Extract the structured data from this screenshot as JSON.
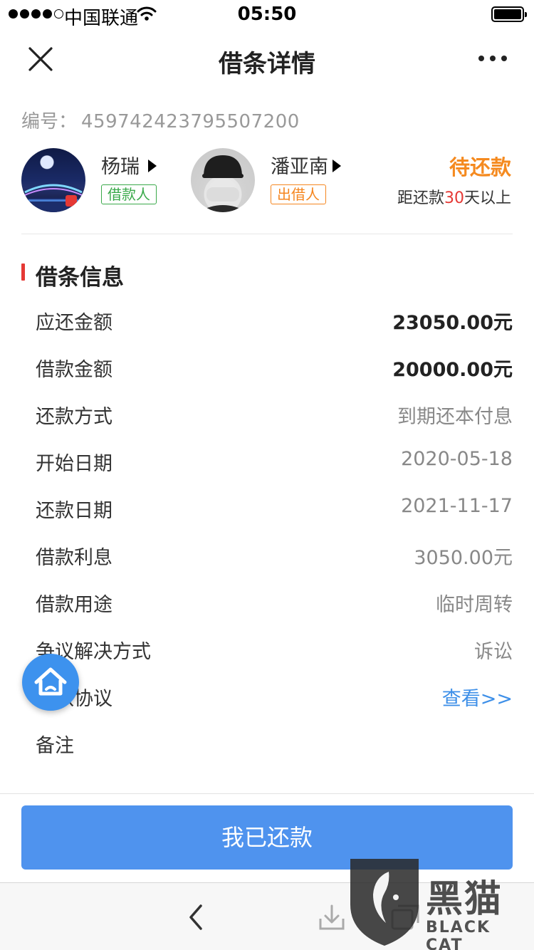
{
  "status_bar": {
    "carrier": "中国联通",
    "time": "05:50"
  },
  "nav": {
    "title": "借条详情"
  },
  "serial": {
    "label": "编号：",
    "value": "459742423795507200"
  },
  "borrower": {
    "name": "杨瑞",
    "role": "借款人"
  },
  "lender": {
    "name": "潘亚南",
    "role": "出借人"
  },
  "loan_status": {
    "label": "待还款",
    "due_prefix": "距还款",
    "due_days": "30",
    "due_suffix": "天以上"
  },
  "section": {
    "title": "借条信息"
  },
  "details": [
    {
      "label": "应还金额",
      "value": "23050.00元"
    },
    {
      "label": "借款金额",
      "value": "20000.00元"
    },
    {
      "label": "还款方式",
      "value": "到期还本付息"
    },
    {
      "label": "开始日期",
      "value": "2020-05-18"
    },
    {
      "label": "还款日期",
      "value": "2021-11-17"
    },
    {
      "label": "借款利息",
      "value": "3050.00元"
    },
    {
      "label": "借款用途",
      "value": "临时周转"
    },
    {
      "label": "争议解决方式",
      "value": "诉讼"
    },
    {
      "label": "借款协议",
      "value": "查看>>"
    },
    {
      "label": "备注",
      "value": ""
    }
  ],
  "actions": {
    "repay_label": "我已还款"
  },
  "watermark": {
    "text": "黑猫",
    "sub": "BLACK CAT"
  },
  "colors": {
    "accent": "#4f93ee",
    "pending": "#f58a1f",
    "borrower_tag": "#3aa94a",
    "lender_tag": "#f5861f",
    "section_marker": "#e53935",
    "link": "#3d8fe8"
  },
  "icons": {
    "close": "close-icon",
    "more": "more-icon",
    "home": "home-icon",
    "back": "back-icon",
    "download": "download-icon",
    "window": "window-icon"
  }
}
